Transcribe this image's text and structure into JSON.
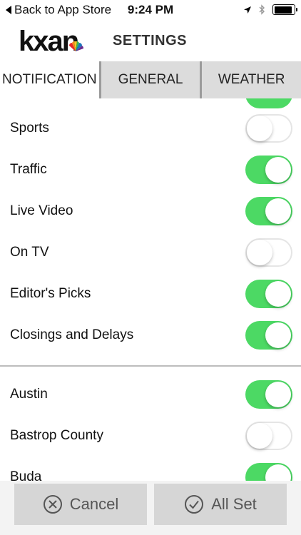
{
  "status_bar": {
    "back_label": "Back to App Store",
    "time": "9:24 PM"
  },
  "header": {
    "logo": "kxan",
    "title": "SETTINGS"
  },
  "tabs": [
    {
      "label": "NOTIFICATION",
      "active": true
    },
    {
      "label": "GENERAL",
      "active": false
    },
    {
      "label": "WEATHER",
      "active": false
    }
  ],
  "categories": [
    {
      "label": "Sports",
      "on": false
    },
    {
      "label": "Traffic",
      "on": true
    },
    {
      "label": "Live Video",
      "on": true
    },
    {
      "label": "On TV",
      "on": false
    },
    {
      "label": "Editor's Picks",
      "on": true
    },
    {
      "label": "Closings and Delays",
      "on": true
    }
  ],
  "locations": [
    {
      "label": "Austin",
      "on": true
    },
    {
      "label": "Bastrop County",
      "on": false
    },
    {
      "label": "Buda",
      "on": true
    }
  ],
  "footer": {
    "cancel_label": "Cancel",
    "allset_label": "All Set"
  },
  "colors": {
    "toggle_on": "#4cd964",
    "tab_bg": "#dcdcdc",
    "button_bg": "#d6d6d6"
  }
}
